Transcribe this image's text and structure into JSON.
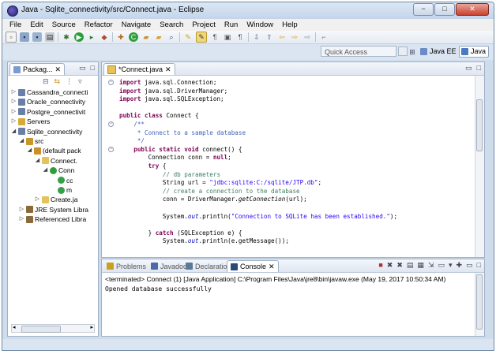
{
  "window": {
    "title": "Java - Sqlite_connectivity/src/Connect.java - Eclipse",
    "controls": {
      "minimize": "−",
      "maximize": "□",
      "close": "✕"
    }
  },
  "menu": [
    "File",
    "Edit",
    "Source",
    "Refactor",
    "Navigate",
    "Search",
    "Project",
    "Run",
    "Window",
    "Help"
  ],
  "quick_access": {
    "placeholder": "Quick Access"
  },
  "perspectives": [
    {
      "label": "Java EE",
      "active": false
    },
    {
      "label": "Java",
      "active": true
    }
  ],
  "package_explorer": {
    "tab_label": "Packag...",
    "items": [
      {
        "label": "Cassandra_connecti",
        "depth": 0,
        "twisty": "▷",
        "icon": "project-icon"
      },
      {
        "label": "Oracle_connectivity",
        "depth": 0,
        "twisty": "▷",
        "icon": "project-icon"
      },
      {
        "label": "Postgre_connectivit",
        "depth": 0,
        "twisty": "▷",
        "icon": "project-icon"
      },
      {
        "label": "Servers",
        "depth": 0,
        "twisty": "▷",
        "icon": "folder-icon"
      },
      {
        "label": "Sqlite_connectivity",
        "depth": 0,
        "twisty": "◢",
        "icon": "project-icon"
      },
      {
        "label": "src",
        "depth": 1,
        "twisty": "◢",
        "icon": "source-folder-icon"
      },
      {
        "label": "(default pack",
        "depth": 2,
        "twisty": "◢",
        "icon": "package-icon"
      },
      {
        "label": "Connect.",
        "depth": 3,
        "twisty": "◢",
        "icon": "java-file-icon"
      },
      {
        "label": "Conn",
        "depth": 4,
        "twisty": "◢",
        "icon": "class-icon"
      },
      {
        "label": "cc",
        "depth": 5,
        "twisty": "",
        "icon": "method-icon"
      },
      {
        "label": "m",
        "depth": 5,
        "twisty": "",
        "icon": "method-icon"
      },
      {
        "label": "Create.ja",
        "depth": 3,
        "twisty": "▷",
        "icon": "java-file-icon"
      },
      {
        "label": "JRE System Libra",
        "depth": 1,
        "twisty": "▷",
        "icon": "library-icon"
      },
      {
        "label": "Referenced Libra",
        "depth": 1,
        "twisty": "▷",
        "icon": "library-icon"
      }
    ]
  },
  "editor": {
    "tab_label": "*Connect.java",
    "lines": [
      [
        [
          "kw",
          "import "
        ],
        [
          "",
          "java.sql.Connection;"
        ]
      ],
      [
        [
          "kw",
          "import "
        ],
        [
          "",
          "java.sql.DriverManager;"
        ]
      ],
      [
        [
          "kw",
          "import "
        ],
        [
          "",
          "java.sql.SQLException;"
        ]
      ],
      [],
      [
        [
          "kw",
          "public class "
        ],
        [
          "",
          "Connect {"
        ]
      ],
      [
        [
          "jd",
          "    /**"
        ]
      ],
      [
        [
          "jd",
          "     * Connect to a sample database"
        ]
      ],
      [
        [
          "jd",
          "     */"
        ]
      ],
      [
        [
          "kw",
          "    public static void "
        ],
        [
          "",
          "connect() {"
        ]
      ],
      [
        [
          "",
          "        Connection conn = "
        ],
        [
          "kw",
          "null"
        ],
        [
          "",
          ";"
        ]
      ],
      [
        [
          "kw",
          "        try "
        ],
        [
          "",
          "{"
        ]
      ],
      [
        [
          "cm",
          "            // db parameters"
        ]
      ],
      [
        [
          "",
          "            String url = "
        ],
        [
          "str",
          "\"jdbc:sqlite:C:/sqlite/JTP.db\""
        ],
        [
          "",
          ";"
        ]
      ],
      [
        [
          "cm",
          "            // create a connection to the database"
        ]
      ],
      [
        [
          "",
          "            conn = DriverManager."
        ],
        [
          "it",
          "getConnection"
        ],
        [
          "",
          "(url);"
        ]
      ],
      [],
      [
        [
          "",
          "            System."
        ],
        [
          "fld",
          "out"
        ],
        [
          "",
          ".println("
        ],
        [
          "str",
          "\"Connection to SQLite has been established.\""
        ],
        [
          "",
          ");"
        ]
      ],
      [],
      [
        [
          "",
          "        } "
        ],
        [
          "kw",
          "catch "
        ],
        [
          "",
          "(SQLException e) {"
        ]
      ],
      [
        [
          "",
          "            System."
        ],
        [
          "fld",
          "out"
        ],
        [
          "",
          ".println(e.getMessage());"
        ]
      ]
    ]
  },
  "bottom_panel": {
    "tabs": [
      {
        "label": "Problems",
        "icon": "problems-icon",
        "active": false
      },
      {
        "label": "Javadoc",
        "icon": "javadoc-icon",
        "active": false
      },
      {
        "label": "Declaration",
        "icon": "declaration-icon",
        "active": false
      },
      {
        "label": "Console",
        "icon": "console-icon",
        "active": true
      }
    ],
    "terminated": "<terminated> Connect (1) [Java Application] C:\\Program Files\\Java\\jre8\\bin\\javaw.exe (May 19, 2017 10:50:34 AM)",
    "output": "Opened database successfully"
  }
}
